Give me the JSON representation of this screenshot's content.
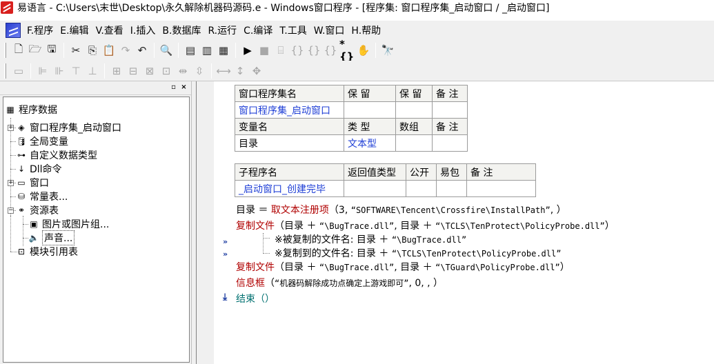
{
  "window": {
    "title": "易语言 - C:\\Users\\末世\\Desktop\\永久解除机器码源码.e - Windows窗口程序 - [程序集: 窗口程序集_启动窗口 / _启动窗口]"
  },
  "menu": [
    "F.程序",
    "E.编辑",
    "V.查看",
    "I.插入",
    "B.数据库",
    "R.运行",
    "C.编译",
    "T.工具",
    "W.窗口",
    "H.帮助"
  ],
  "panel_buttons": [
    "▫",
    "×"
  ],
  "tree": {
    "root": "程序数据",
    "items": [
      "窗口程序集_启动窗口",
      "全局变量",
      "自定义数据类型",
      "Dll命令",
      "窗口",
      "常量表...",
      "资源表"
    ],
    "resources": [
      "图片或图片组...",
      "声音..."
    ],
    "last": "模块引用表"
  },
  "assembly_table": {
    "headers": [
      "窗口程序集名",
      "保 留",
      "保 留",
      "备 注"
    ],
    "row": [
      "窗口程序集_启动窗口",
      "",
      "",
      ""
    ],
    "var_headers": [
      "变量名",
      "类 型",
      "数组",
      "备 注"
    ],
    "var_row": [
      "目录",
      "文本型",
      "",
      ""
    ]
  },
  "sub_table": {
    "headers": [
      "子程序名",
      "返回值类型",
      "公开",
      "易包",
      "备 注"
    ],
    "row": [
      "_启动窗口_创建完毕",
      "",
      "",
      "",
      ""
    ]
  },
  "code": {
    "line1": {
      "a": "目录 ＝ ",
      "fn": "取文本注册项",
      "b": "（3, ",
      "str": "“SOFTWARE\\Tencent\\Crossfire\\InstallPath”",
      "c": ", ）"
    },
    "line2": {
      "fn": "复制文件",
      "a": "（目录 ＋ ",
      "s1": "“\\BugTrace.dll”",
      "b": ", 目录 ＋ ",
      "s2": "“\\TCLS\\TenProtect\\PolicyProbe.dll”",
      "c": "）"
    },
    "line3": {
      "a": "※被复制的文件名: 目录 ＋ ",
      "str": "“\\BugTrace.dll”"
    },
    "line4": {
      "a": "※复制到的文件名: 目录 ＋ ",
      "str": "“\\TCLS\\TenProtect\\PolicyProbe.dll”"
    },
    "line5": {
      "fn": "复制文件",
      "a": "（目录 ＋ ",
      "s1": "“\\BugTrace.dll”",
      "b": ", 目录 ＋ ",
      "s2": "“\\TGuard\\PolicyProbe.dll”",
      "c": "）"
    },
    "line6": {
      "fn": "信息框",
      "a": "（",
      "str": "“机器码解除成功点确定上游戏即可”",
      "b": ", 0, , ）"
    },
    "line7": {
      "fn": "结束",
      "a": "（）"
    }
  }
}
